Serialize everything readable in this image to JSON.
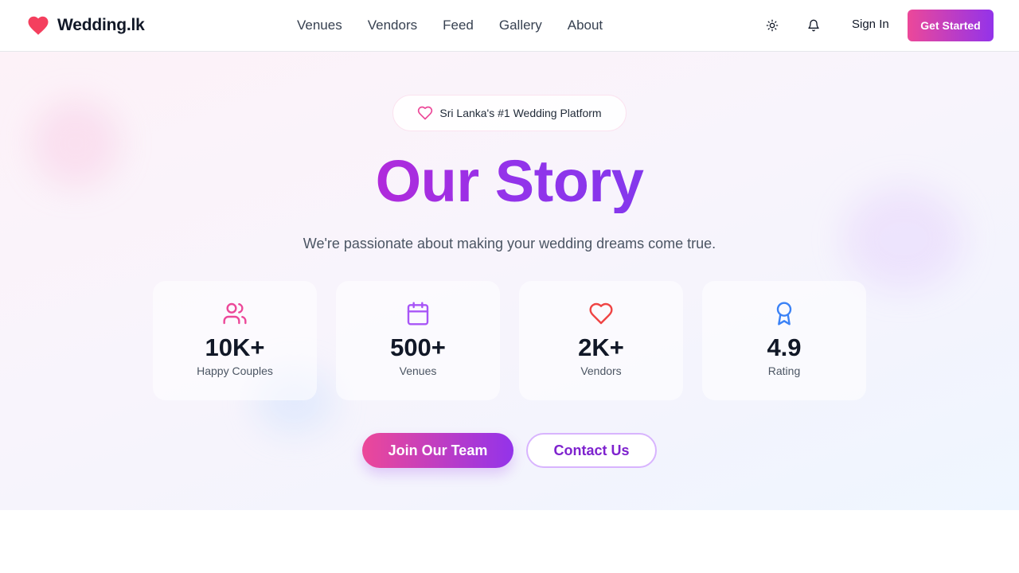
{
  "header": {
    "brand": "Wedding.lk",
    "nav": [
      "Venues",
      "Vendors",
      "Feed",
      "Gallery",
      "About"
    ],
    "theme_icon": "sun-icon",
    "notification_icon": "bell-icon",
    "sign_in": "Sign In",
    "get_started": "Get Started"
  },
  "hero": {
    "badge": "Sri Lanka's #1 Wedding Platform",
    "title": "Our Story",
    "subtitle": "We're passionate about making your wedding dreams come true.",
    "stats": [
      {
        "value": "10K+",
        "label": "Happy Couples",
        "icon": "users-icon",
        "color": "#ec4899"
      },
      {
        "value": "500+",
        "label": "Venues",
        "icon": "calendar-icon",
        "color": "#a855f7"
      },
      {
        "value": "2K+",
        "label": "Vendors",
        "icon": "heart-icon",
        "color": "#ef4444"
      },
      {
        "value": "4.9",
        "label": "Rating",
        "icon": "award-icon",
        "color": "#3b82f6"
      }
    ],
    "primary_button": "Join Our Team",
    "secondary_button": "Contact Us"
  },
  "colors": {
    "brand_pink": "#ec4899",
    "brand_purple": "#9333ea",
    "logo_heart": "#f43f5e"
  }
}
